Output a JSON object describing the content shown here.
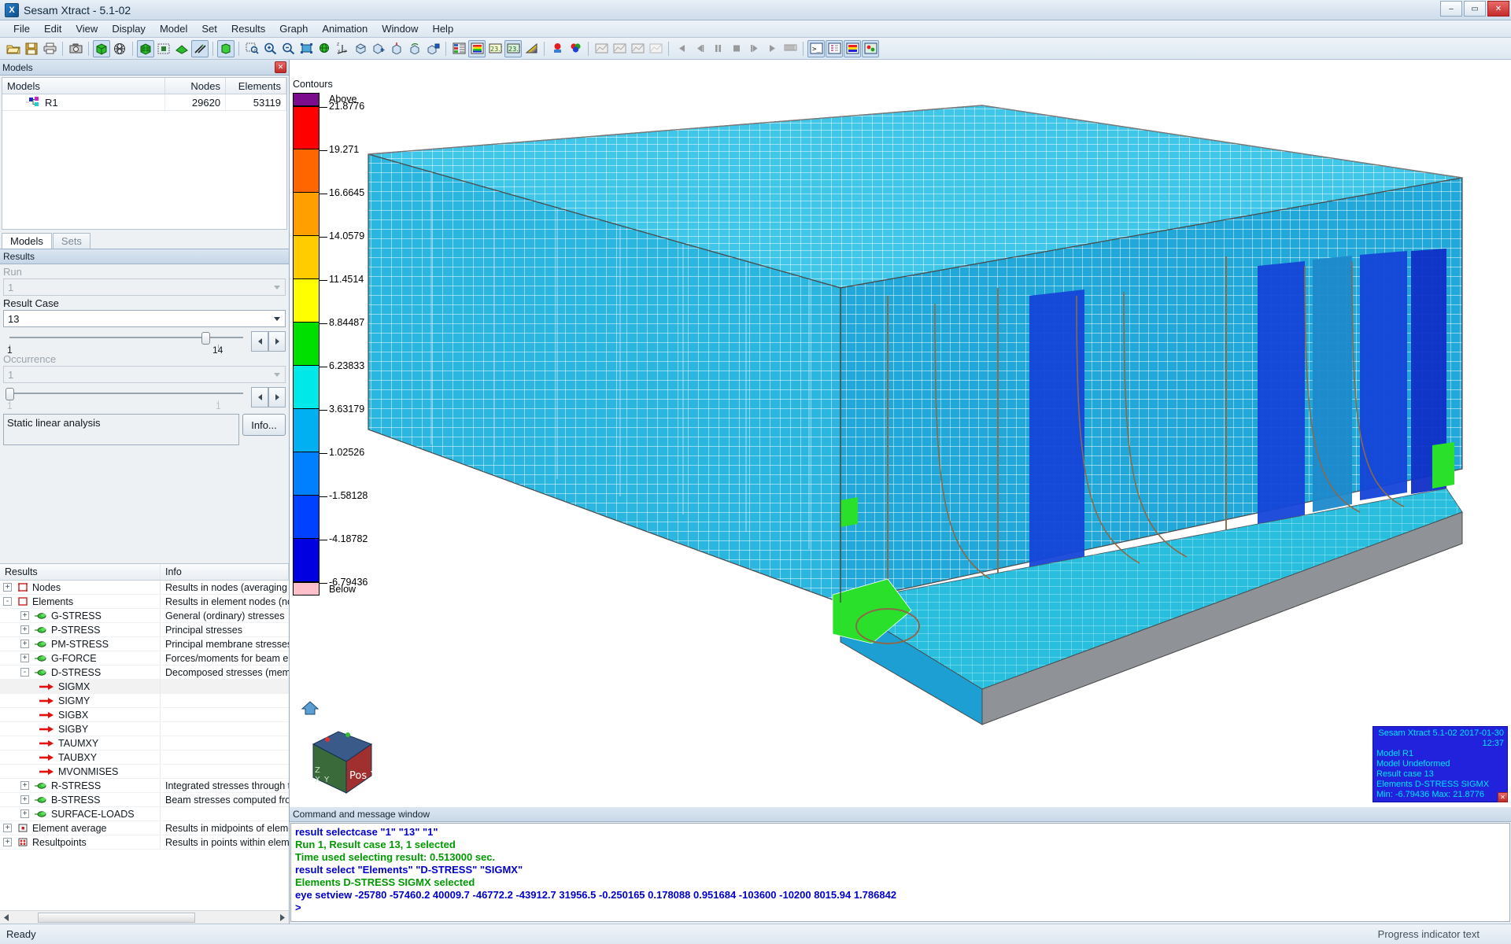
{
  "window": {
    "title": "Sesam Xtract - 5.1-02",
    "icon": "app-icon",
    "minimize": "–",
    "maximize": "▭",
    "close": "✕"
  },
  "menu": [
    "File",
    "Edit",
    "View",
    "Display",
    "Model",
    "Set",
    "Results",
    "Graph",
    "Animation",
    "Window",
    "Help"
  ],
  "toolbar": {
    "groups": [
      [
        "open-icon",
        "save-icon",
        "print-icon"
      ],
      [
        "camera-icon"
      ],
      [
        "solid-cube-icon",
        "wireframe-sphere-icon"
      ],
      [
        "mesh-cube-icon",
        "filled-square-icon",
        "shaded-solid-icon",
        "arrow-pair-icon"
      ],
      [
        "green-box-icon"
      ],
      [
        "zoom-window-icon",
        "zoom-in-icon",
        "zoom-out-icon",
        "zoom-fit-icon",
        "rotate-icon",
        "axes-icon",
        "view-rotate-icon",
        "view-plus-icon",
        "view-up-icon",
        "view-prev-icon",
        "view-save-icon"
      ],
      [
        "contour-table-icon",
        "color-legend-icon",
        "label-value-icon",
        "label-node-icon",
        "gradient-icon"
      ],
      [
        "single-color-icon",
        "multi-color-icon"
      ],
      [
        "graph1-icon",
        "graph2-icon",
        "graph3-icon",
        "graph4-icon"
      ],
      [
        "anim-first-icon",
        "anim-prev-icon",
        "anim-pause-icon",
        "anim-stop-icon",
        "anim-next-icon",
        "anim-play-icon",
        "anim-film-icon"
      ],
      [
        "console-icon",
        "tree-icon",
        "contour-window-icon",
        "result-window-icon"
      ]
    ]
  },
  "models_panel": {
    "title": "Models",
    "close": "✕",
    "columns": [
      "Models",
      "Nodes",
      "Elements"
    ],
    "rows": [
      {
        "name": "R1",
        "nodes": "29620",
        "elements": "53119"
      }
    ],
    "tabs": [
      {
        "label": "Models",
        "active": true
      },
      {
        "label": "Sets",
        "active": false
      }
    ]
  },
  "results_panel": {
    "title": "Results",
    "run_label": "Run",
    "run_value": "1",
    "result_case_label": "Result Case",
    "result_case_value": "13",
    "result_case_min": "1",
    "result_case_max": "14",
    "occurrence_label": "Occurrence",
    "occurrence_value": "1",
    "occurrence_min": "1",
    "occurrence_max": "1",
    "analysis_text": "Static linear analysis",
    "info_button": "Info...",
    "tree_columns": [
      "Results",
      "Info"
    ],
    "tree": [
      {
        "indent": 0,
        "toggle": "+",
        "icon": "node-icon",
        "label": "Nodes",
        "info": "Results in nodes (averaging of",
        "selected": false
      },
      {
        "indent": 0,
        "toggle": "-",
        "icon": "element-icon",
        "label": "Elements",
        "info": "Results in element nodes (no",
        "selected": false
      },
      {
        "indent": 1,
        "toggle": "+",
        "icon": "stress-icon",
        "label": "G-STRESS",
        "info": "General (ordinary) stresses",
        "selected": false
      },
      {
        "indent": 1,
        "toggle": "+",
        "icon": "stress-icon",
        "label": "P-STRESS",
        "info": "Principal stresses",
        "selected": false
      },
      {
        "indent": 1,
        "toggle": "+",
        "icon": "stress-icon",
        "label": "PM-STRESS",
        "info": "Principal membrane stresses f",
        "selected": false
      },
      {
        "indent": 1,
        "toggle": "+",
        "icon": "stress-icon",
        "label": "G-FORCE",
        "info": "Forces/moments for beam ele",
        "selected": false
      },
      {
        "indent": 1,
        "toggle": "-",
        "icon": "stress-icon",
        "label": "D-STRESS",
        "info": "Decomposed stresses (memb",
        "selected": false
      },
      {
        "indent": 2,
        "toggle": "",
        "icon": "arrow-icon",
        "label": "SIGMX",
        "info": "",
        "selected": true
      },
      {
        "indent": 2,
        "toggle": "",
        "icon": "arrow-icon",
        "label": "SIGMY",
        "info": "",
        "selected": false
      },
      {
        "indent": 2,
        "toggle": "",
        "icon": "arrow-icon",
        "label": "SIGBX",
        "info": "",
        "selected": false
      },
      {
        "indent": 2,
        "toggle": "",
        "icon": "arrow-icon",
        "label": "SIGBY",
        "info": "",
        "selected": false
      },
      {
        "indent": 2,
        "toggle": "",
        "icon": "arrow-icon",
        "label": "TAUMXY",
        "info": "",
        "selected": false
      },
      {
        "indent": 2,
        "toggle": "",
        "icon": "arrow-icon",
        "label": "TAUBXY",
        "info": "",
        "selected": false
      },
      {
        "indent": 2,
        "toggle": "",
        "icon": "arrow-icon",
        "label": "MVONMISES",
        "info": "",
        "selected": false
      },
      {
        "indent": 1,
        "toggle": "+",
        "icon": "stress-icon",
        "label": "R-STRESS",
        "info": "Integrated stresses through th",
        "selected": false
      },
      {
        "indent": 1,
        "toggle": "+",
        "icon": "stress-icon",
        "label": "B-STRESS",
        "info": "Beam stresses computed from",
        "selected": false
      },
      {
        "indent": 1,
        "toggle": "+",
        "icon": "stress-icon",
        "label": "SURFACE-LOADS",
        "info": "",
        "selected": false
      },
      {
        "indent": 0,
        "toggle": "+",
        "icon": "avg-icon",
        "label": "Element average",
        "info": "Results in midpoints of eleme",
        "selected": false
      },
      {
        "indent": 0,
        "toggle": "+",
        "icon": "point-icon",
        "label": "Resultpoints",
        "info": "Results in points within eleme",
        "selected": false
      }
    ]
  },
  "chart_data": {
    "type": "heatmap",
    "title": "Contours",
    "above_label": "Above",
    "below_label": "Below",
    "above_color": "#7B0C8C",
    "below_color": "#FFC0CB",
    "levels": [
      "21.8776",
      "19.271",
      "16.6645",
      "14.0579",
      "11.4514",
      "8.84487",
      "6.23833",
      "3.63179",
      "1.02526",
      "-1.58128",
      "-4.18782",
      "-6.79436"
    ],
    "band_colors": [
      "#FF0000",
      "#FF6600",
      "#FFA000",
      "#FFCC00",
      "#FFFF00",
      "#00E000",
      "#00E8E8",
      "#00B0F0",
      "#0080FF",
      "#0040FF",
      "#0000E0"
    ],
    "min": -6.79436,
    "max": 21.8776,
    "quantity": "D-STRESS SIGMX"
  },
  "view": {
    "triad_labels": {
      "x": "X",
      "y": "Y",
      "z": "Z",
      "face": "Pos X"
    },
    "home_icon": "home-icon",
    "info_overlay": {
      "product": "Sesam Xtract 5.1-02 2017-01-30",
      "time": "12:37",
      "lines": [
        "Model R1",
        "Model Undeformed",
        "Result case 13",
        "Elements D-STRESS SIGMX",
        "Min: -6.79436 Max: 21.8776"
      ],
      "close": "✕"
    }
  },
  "command_window": {
    "title": "Command and message window",
    "lines": [
      {
        "text": "result selectcase \"1\" \"13\" \"1\"",
        "color": "blue"
      },
      {
        "text": "Run 1, Result case 13, 1 selected",
        "color": "green"
      },
      {
        "text": "Time used selecting result: 0.513000 sec.",
        "color": "green"
      },
      {
        "text": "result select \"Elements\" \"D-STRESS\" \"SIGMX\"",
        "color": "blue"
      },
      {
        "text": "Elements D-STRESS SIGMX selected",
        "color": "green"
      },
      {
        "text": "eye setview -25780 -57460.2 40009.7 -46772.2 -43912.7 31956.5 -0.250165 0.178088 0.951684 -103600 -10200 8015.94 1.786842",
        "color": "blue"
      },
      {
        "text": ">",
        "color": "blue"
      }
    ]
  },
  "statusbar": {
    "left": "Ready",
    "right": "Progress indicator text"
  }
}
